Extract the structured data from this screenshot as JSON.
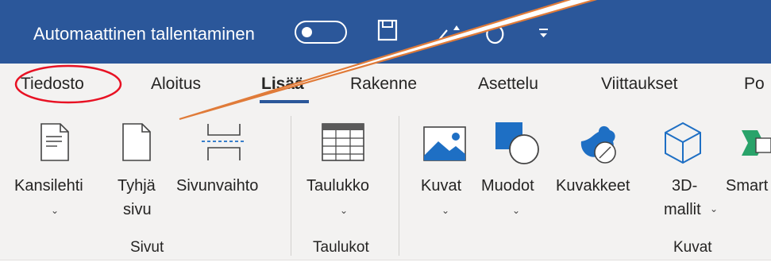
{
  "titlebar": {
    "autosave_label": "Automaattinen tallentaminen",
    "icons": [
      "save-icon",
      "undo-icon",
      "redo-icon",
      "customize-quick-access-icon"
    ]
  },
  "tabs": [
    {
      "label": "Tiedosto"
    },
    {
      "label": "Aloitus"
    },
    {
      "label": "Lisää",
      "active": true
    },
    {
      "label": "Rakenne"
    },
    {
      "label": "Asettelu"
    },
    {
      "label": "Viittaukset"
    },
    {
      "label": "Po"
    }
  ],
  "ribbon": {
    "groups": {
      "sivut": "Sivut",
      "taulukot": "Taulukot",
      "kuvat": "Kuvat"
    },
    "buttons": {
      "kansilehti": "Kansilehti",
      "tyhja_line1": "Tyhjä",
      "tyhja_line2": "sivu",
      "sivunvaihto": "Sivunvaihto",
      "taulukko": "Taulukko",
      "kuvat": "Kuvat",
      "muodot": "Muodot",
      "kuvakkeet": "Kuvakkeet",
      "malli_line1": "3D-",
      "malli_line2": "mallit",
      "smart": "Smart"
    }
  },
  "colors": {
    "titlebar": "#2b579a",
    "annotation_red": "#e81123",
    "callout_orange": "#e07b39",
    "icon_blue": "#1e6fc4"
  }
}
